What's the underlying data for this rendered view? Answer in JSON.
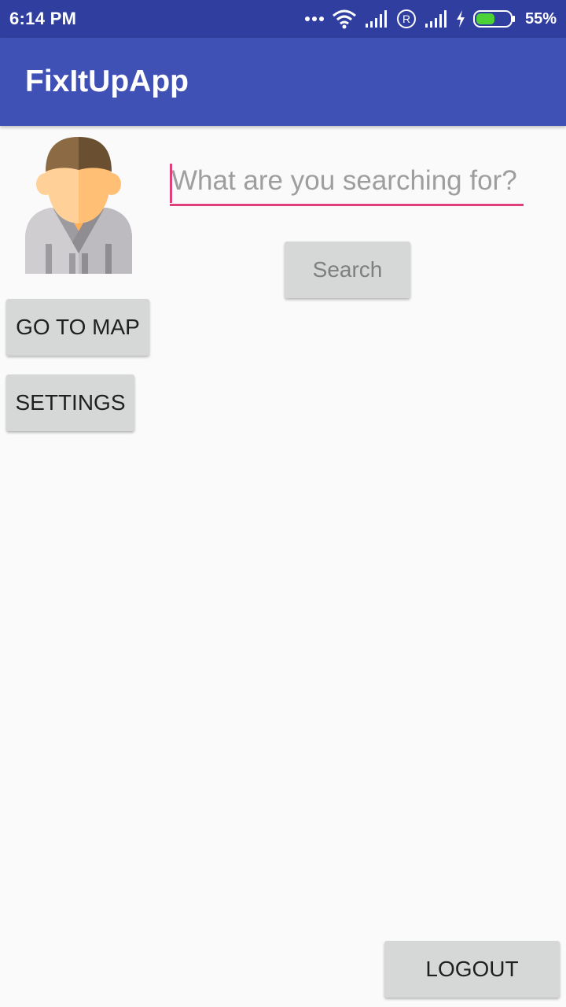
{
  "status_bar": {
    "time": "6:14 PM",
    "battery_percent": "55%",
    "battery_level": 0.55,
    "icons": [
      "more-dots-icon",
      "wifi-icon",
      "signal-icon",
      "roaming-r-icon",
      "signal-icon",
      "charging-bolt-icon",
      "battery-icon"
    ]
  },
  "app_bar": {
    "title": "FixItUpApp"
  },
  "avatar": {
    "icon": "user-avatar-icon"
  },
  "search": {
    "placeholder": "What are you searching for?",
    "value": "",
    "button_label": "Search"
  },
  "nav": {
    "map_label": "GO TO MAP",
    "settings_label": "SETTINGS"
  },
  "footer": {
    "logout_label": "LOGOUT"
  },
  "colors": {
    "status_bar": "#303f9f",
    "primary": "#3f51b5",
    "accent": "#e0407a",
    "button": "#d6d7d7",
    "background": "#fafafa"
  }
}
